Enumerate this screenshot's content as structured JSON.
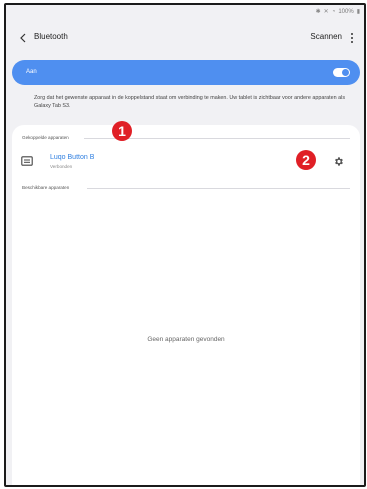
{
  "status_bar": {
    "battery": "100%"
  },
  "header": {
    "title": "Bluetooth",
    "scan_label": "Scannen"
  },
  "toggle": {
    "label": "Aan",
    "state": "on",
    "accent": "#4f8ff0"
  },
  "description": "Zorg dat het gewenste apparaat in de koppelstand staat om verbinding te maken. Uw tablet is zichtbaar voor andere apparaten als Galaxy Tab S3.",
  "paired": {
    "section_title": "Gekoppelde apparaten",
    "devices": [
      {
        "name": "Luqo Button B",
        "status": "Verbonden",
        "icon": "keyboard-icon"
      }
    ]
  },
  "available": {
    "section_title": "Beschikbare apparaten",
    "empty_text": "Geen apparaten gevonden"
  },
  "annotations": {
    "marker_1": "1",
    "marker_2": "2",
    "marker_color": "#e01f26"
  }
}
